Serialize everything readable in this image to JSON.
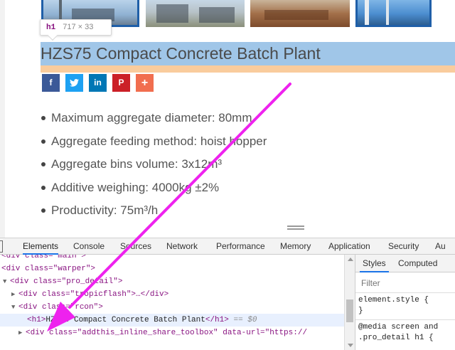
{
  "gallery": {
    "thumbnails": [
      "plant-photo-1",
      "plant-photo-2",
      "plant-photo-3",
      "plant-photo-4"
    ]
  },
  "hover_tooltip": {
    "tag": "h1",
    "size": "717 × 33"
  },
  "product": {
    "title": "HZS75 Compact Concrete Batch Plant",
    "share": {
      "facebook": "f",
      "twitter": "t",
      "linkedin": "in",
      "pinterest": "P",
      "more": "+"
    },
    "specs": [
      "Maximum aggregate diameter: 80mm",
      "Aggregate feeding method: hoist hopper",
      "Aggregate bins volume: 3x12m³",
      "Additive weighing: 4000kg ±2%",
      "Productivity: 75m³/h"
    ]
  },
  "devtools": {
    "tabs": [
      "Elements",
      "Console",
      "Sources",
      "Network",
      "Performance",
      "Memory",
      "Application",
      "Security",
      "Au"
    ],
    "active_tab": "Elements",
    "dom": {
      "l0": "<div class=\"main\">",
      "l1": "<div class=\"warper\">",
      "l2": "<div class=\"pro_detail\">",
      "l3a": "<div class=\"tropicflash\">",
      "l3b": "…</div>",
      "l4": "<div class=\"rcon\">",
      "l5_open": "<h1>",
      "l5_text": "HZS75 Compact Concrete Batch Plant",
      "l5_close": "</h1>",
      "l5_eq": "== $0",
      "l6": "<div class=\"addthis_inline_share_toolbox\" data-url=\"https://"
    },
    "styles": {
      "tabs": [
        "Styles",
        "Computed"
      ],
      "filter_placeholder": "Filter",
      "rule1_sel": "element.style {",
      "rule1_end": "}",
      "rule2_media": "@media screen and",
      "rule2_sel": ".pro_detail h1 {"
    }
  },
  "colors": {
    "highlight_content": "#6fa8dc",
    "highlight_margin": "#f6b26b",
    "annotation_arrow": "#ee22ee",
    "devtools_active": "#1a73e8"
  }
}
